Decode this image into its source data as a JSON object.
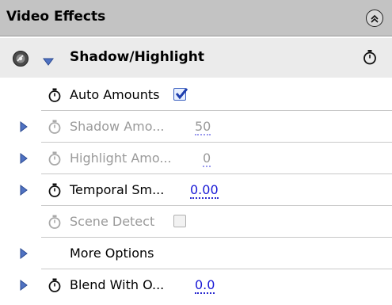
{
  "panel": {
    "title": "Video Effects"
  },
  "effect": {
    "name": "Shadow/Highlight"
  },
  "properties": [
    {
      "label": "Auto Amounts",
      "checked": true
    },
    {
      "label": "Shadow Amo...",
      "value": "50"
    },
    {
      "label": "Highlight Amo...",
      "value": "0"
    },
    {
      "label": "Temporal Sm...",
      "value": "0.00"
    },
    {
      "label": "Scene Detect",
      "checked": false
    },
    {
      "label": "More Options"
    },
    {
      "label": "Blend With O...",
      "value": "0.0"
    }
  ],
  "icons": {
    "collapse": "collapse-panel-icon",
    "fx": "effect-toggle-icon",
    "twirl_open": "twirl-down-icon",
    "twirl_closed": "twirl-right-icon",
    "stopwatch": "stopwatch-icon",
    "reset": "reset-effect-icon"
  },
  "colors": {
    "header_bg": "#c3c3c3",
    "effect_row_bg": "#ebebeb",
    "twirl": "#4f72c2",
    "value_active": "#1a1ad6",
    "disabled_text": "#9a9a9a"
  }
}
